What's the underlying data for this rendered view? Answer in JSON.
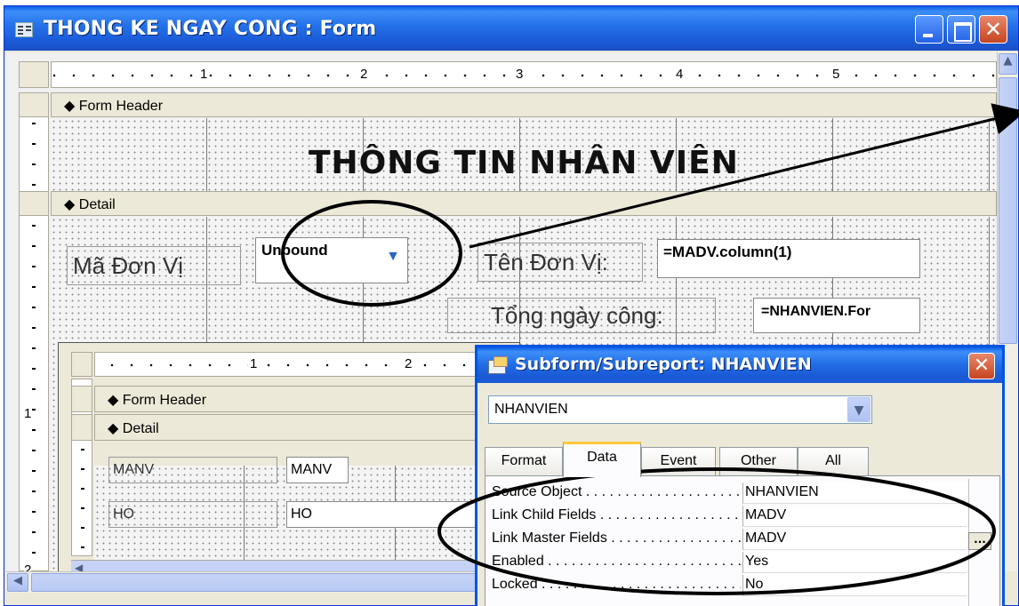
{
  "window": {
    "title": "THONG KE NGAY CONG : Form"
  },
  "ruler": {
    "marks": [
      "1",
      "2",
      "3",
      "4",
      "5"
    ],
    "vertical_marks": [
      "1",
      "2"
    ]
  },
  "sections": {
    "form_header": "Form Header",
    "detail": "Detail"
  },
  "form": {
    "heading": "THÔNG TIN NHÂN VIÊN",
    "ma_don_vi_label": "Mã Đơn Vị",
    "unbound_combo": "Unbound",
    "ten_don_vi_label": "Tên Đơn Vị:",
    "ten_don_vi_value": "=MADV.column(1)",
    "tong_ngay_cong_label": "Tổng ngày công:",
    "tong_ngay_cong_value": "=NHANVIEN.For"
  },
  "subform": {
    "ruler_marks": [
      "1",
      "2"
    ],
    "form_header": "Form Header",
    "detail": "Detail",
    "fields": [
      {
        "label": "MANV",
        "control": "MANV"
      },
      {
        "label": "HO",
        "control": "HO"
      }
    ]
  },
  "property_sheet": {
    "title": "Subform/Subreport: NHANVIEN",
    "selected_object": "NHANVIEN",
    "tabs": [
      "Format",
      "Data",
      "Event",
      "Other",
      "All"
    ],
    "active_tab": "Data",
    "properties": [
      {
        "name": "Source Object",
        "value": "NHANVIEN"
      },
      {
        "name": "Link Child Fields",
        "value": "MADV"
      },
      {
        "name": "Link Master Fields",
        "value": "MADV"
      },
      {
        "name": "Enabled",
        "value": "Yes"
      },
      {
        "name": "Locked",
        "value": "No"
      }
    ],
    "builder_button": "..."
  },
  "icons": {
    "close": "✕",
    "up_arrow": "▲",
    "left_arrow": "◀",
    "dropdown": "▼",
    "section_marker": "◆"
  }
}
